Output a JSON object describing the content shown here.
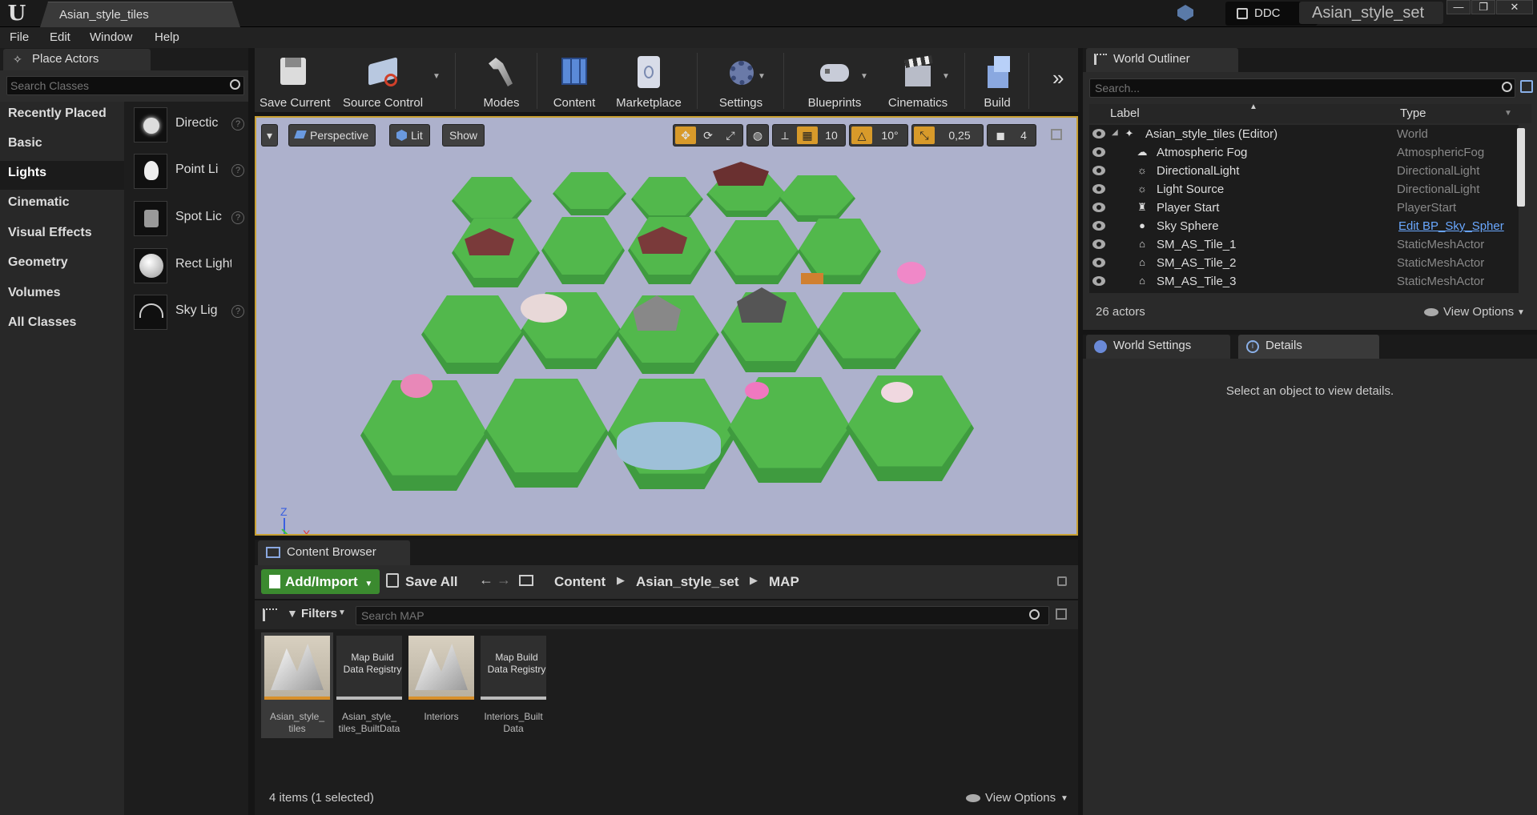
{
  "window": {
    "tab_title": "Asian_style_tiles",
    "ddc_label": "DDC",
    "project_name": "Asian_style_set",
    "minimize": "—",
    "maximize": "❐",
    "close": "✕"
  },
  "menu": [
    "File",
    "Edit",
    "Window",
    "Help"
  ],
  "place_actors": {
    "tab_label": "Place Actors",
    "search_placeholder": "Search Classes",
    "categories": [
      "Recently Placed",
      "Basic",
      "Lights",
      "Cinematic",
      "Visual Effects",
      "Geometry",
      "Volumes",
      "All Classes"
    ],
    "selected_category": "Lights",
    "actors": [
      "Directic",
      "Point Li",
      "Spot Lic",
      "Rect Light",
      "Sky Lig"
    ]
  },
  "toolbar": {
    "save_current": "Save Current",
    "source_control": "Source Control",
    "modes": "Modes",
    "content": "Content",
    "marketplace": "Marketplace",
    "settings": "Settings",
    "blueprints": "Blueprints",
    "cinematics": "Cinematics",
    "build": "Build"
  },
  "viewport": {
    "perspective": "Perspective",
    "lit": "Lit",
    "show": "Show",
    "grid_snap": "10",
    "rotation_snap": "10°",
    "scale_snap": "0,25",
    "camera_speed": "4",
    "axis_z": "Z",
    "axis_x": "X"
  },
  "content_browser": {
    "tab_label": "Content Browser",
    "add_import": "Add/Import",
    "save_all": "Save All",
    "breadcrumb": [
      "Content",
      "Asian_style_set",
      "MAP"
    ],
    "filters": "Filters",
    "search_placeholder": "Search MAP",
    "assets": [
      {
        "name": "Asian_style_ tiles",
        "kind": "map",
        "selected": true
      },
      {
        "name": "Asian_style_ tiles_BuiltData",
        "kind": "registry",
        "thumb_label": "Map Build Data Registry"
      },
      {
        "name": "Interiors",
        "kind": "map"
      },
      {
        "name": "Interiors_Built Data",
        "kind": "registry",
        "thumb_label": "Map Build Data Registry"
      }
    ],
    "status": "4 items (1 selected)",
    "view_options": "View Options"
  },
  "world_outliner": {
    "tab_label": "World Outliner",
    "search_placeholder": "Search...",
    "col_label": "Label",
    "col_type": "Type",
    "rows": [
      {
        "label": "Asian_style_tiles (Editor)",
        "type": "World",
        "icon": "world-icon"
      },
      {
        "label": "Atmospheric Fog",
        "type": "AtmosphericFog",
        "icon": "fog-icon"
      },
      {
        "label": "DirectionalLight",
        "type": "DirectionalLight",
        "icon": "sun-icon"
      },
      {
        "label": "Light Source",
        "type": "DirectionalLight",
        "icon": "sun-icon"
      },
      {
        "label": "Player Start",
        "type": "PlayerStart",
        "icon": "player-icon"
      },
      {
        "label": "Sky Sphere",
        "type": "Edit BP_Sky_Spher",
        "icon": "sphere-icon",
        "link": true
      },
      {
        "label": "SM_AS_Tile_1",
        "type": "StaticMeshActor",
        "icon": "mesh-icon"
      },
      {
        "label": "SM_AS_Tile_2",
        "type": "StaticMeshActor",
        "icon": "mesh-icon"
      },
      {
        "label": "SM_AS_Tile_3",
        "type": "StaticMeshActor",
        "icon": "mesh-icon"
      }
    ],
    "actor_count": "26 actors",
    "view_options": "View Options"
  },
  "details": {
    "world_settings_tab": "World Settings",
    "details_tab": "Details",
    "empty_message": "Select an object to view details."
  }
}
